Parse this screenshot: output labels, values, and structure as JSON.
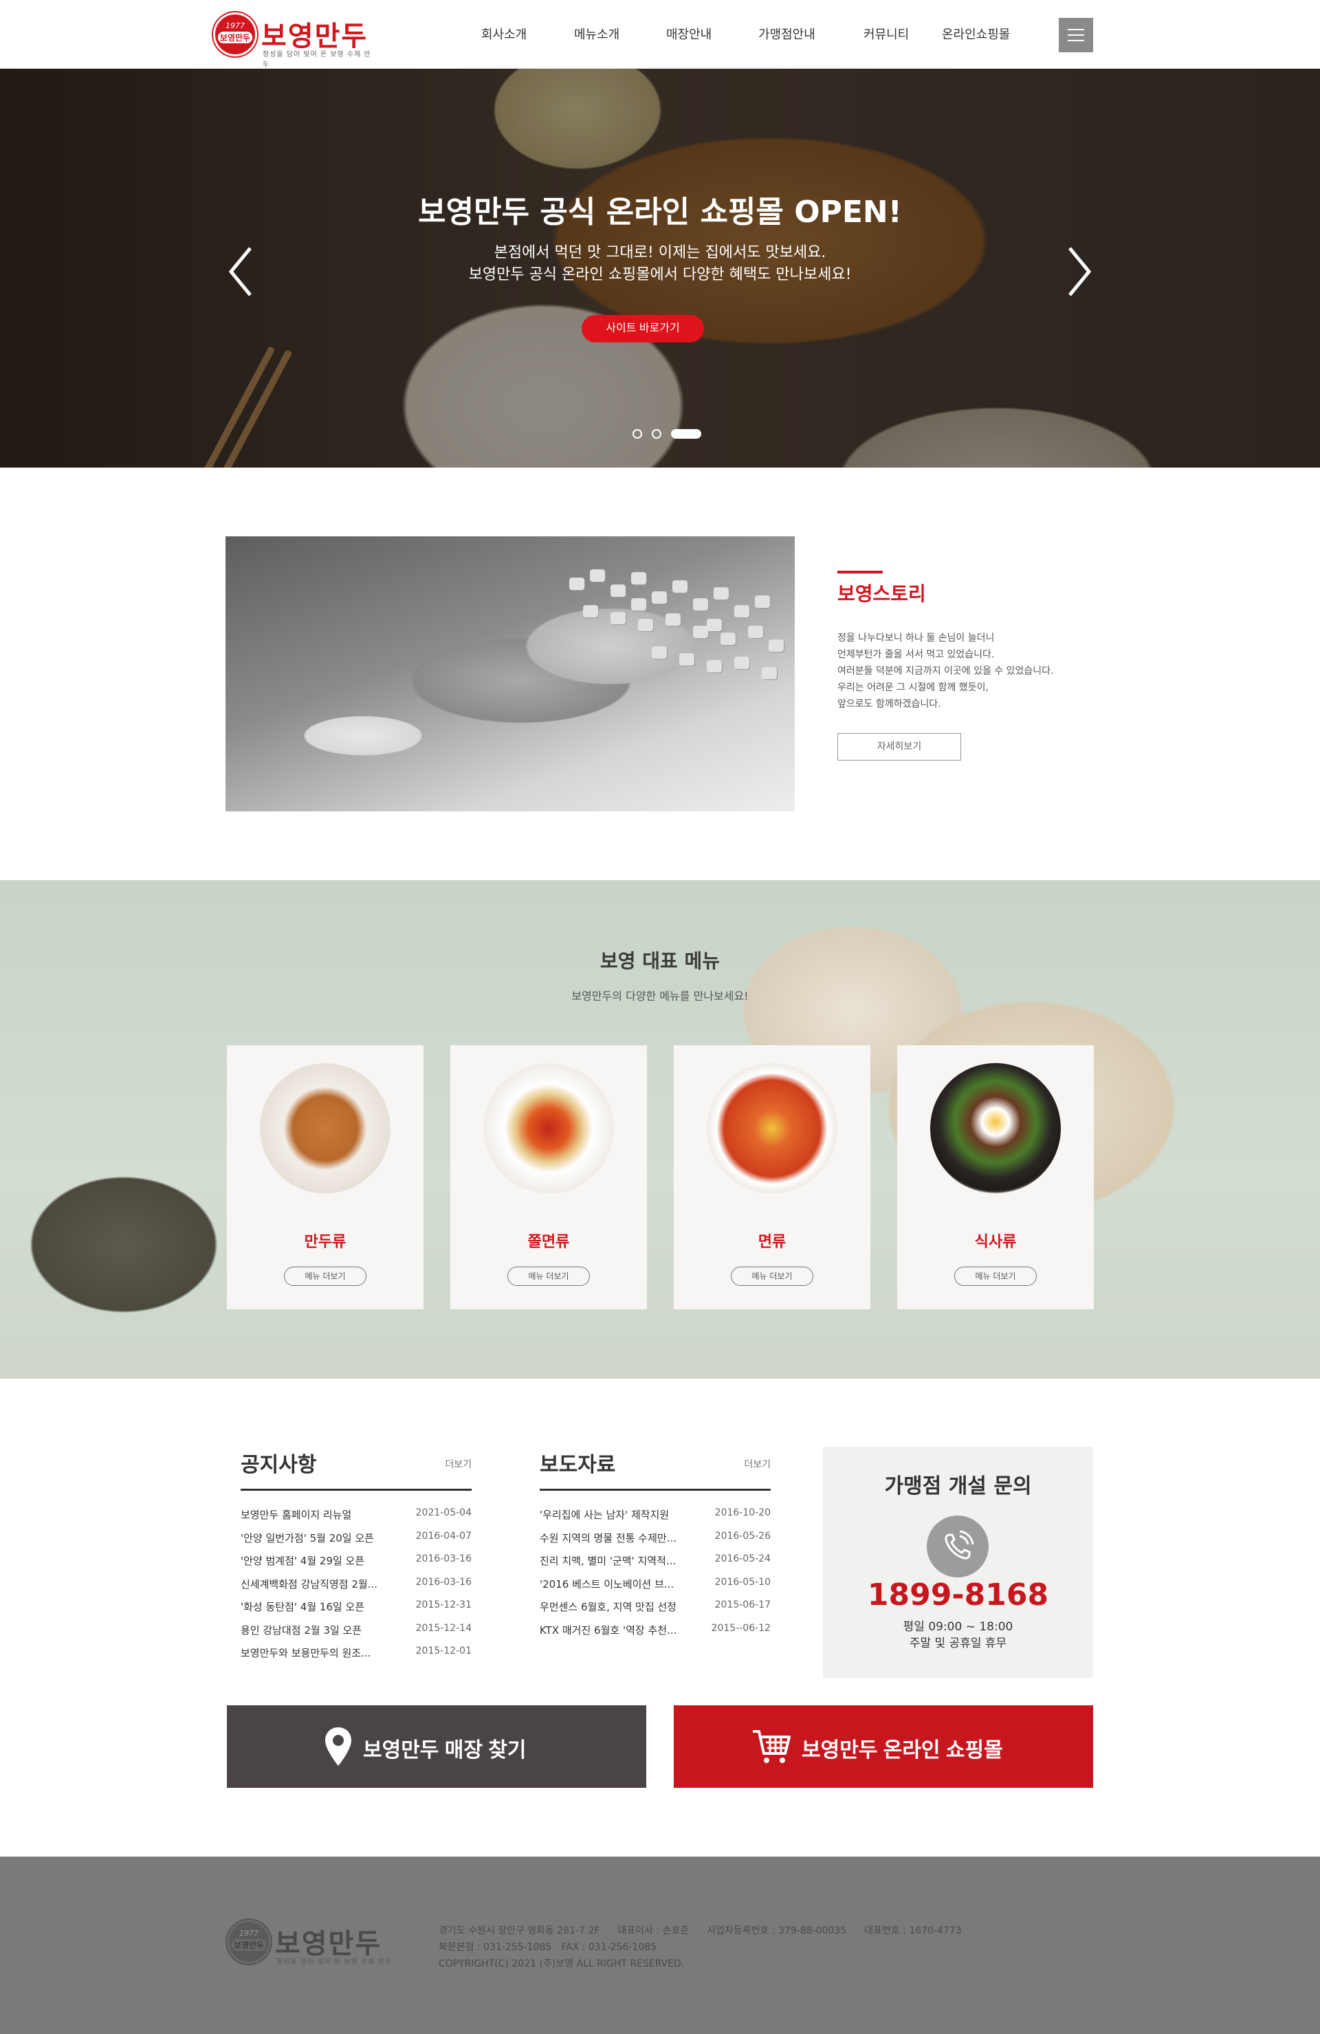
{
  "header": {
    "logo": {
      "year": "1977",
      "seal_name": "보영만두",
      "brand": "보영만두",
      "tagline": "정성을 담아 빚어 온 보영 수제 만두"
    },
    "nav": [
      "회사소개",
      "메뉴소개",
      "매장안내",
      "가맹점안내",
      "커뮤니티",
      "온라인쇼핑몰"
    ]
  },
  "hero": {
    "title": "보영만두 공식 온라인 쇼핑몰 OPEN!",
    "subtitle_lines": [
      "본점에서 먹던 맛 그대로! 이제는 집에서도 맛보세요.",
      "보영만두 공식 온라인 쇼핑몰에서 다양한 혜택도 만나보세요!"
    ],
    "button": "사이트 바로가기",
    "slide_count": 3,
    "active_slide": 3
  },
  "story": {
    "title": "보영스토리",
    "lines": [
      "정을 나누다보니 하나 둘 손님이 늘더니",
      "언제부턴가 줄을 서서 먹고 있었습니다.",
      "여러분들 덕분에 지금까지 이곳에 있을 수 있었습니다.",
      "우리는 어려운 그 시절에 함께 했듯이,",
      "앞으로도 함께하겠습니다."
    ],
    "button": "자세히보기"
  },
  "menu": {
    "title": "보영 대표 메뉴",
    "subtitle": "보영만두의 다양한 메뉴를 만나보세요!",
    "items": [
      {
        "name": "만두류",
        "button": "메뉴 더보기"
      },
      {
        "name": "쫄면류",
        "button": "메뉴 더보기"
      },
      {
        "name": "면류",
        "button": "메뉴 더보기"
      },
      {
        "name": "식사류",
        "button": "메뉴 더보기"
      }
    ]
  },
  "notice": {
    "title": "공지사항",
    "more": "더보기",
    "rows": [
      {
        "title": "보영만두 홈페이지 리뉴얼",
        "date": "2021-05-04"
      },
      {
        "title": "'안양 일번가점' 5월 20일 오픈",
        "date": "2016-04-07"
      },
      {
        "title": "'안양 범계점' 4월 29일 오픈",
        "date": "2016-03-16"
      },
      {
        "title": "신세계백화점 강남직영점 2월...",
        "date": "2016-03-16"
      },
      {
        "title": "'화성 동탄점' 4월 16일 오픈",
        "date": "2015-12-31"
      },
      {
        "title": "용인 강남대점 2월 3일 오픈",
        "date": "2015-12-14"
      },
      {
        "title": "보영만두와 보용만두의 원조...",
        "date": "2015-12-01"
      }
    ]
  },
  "press": {
    "title": "보도자료",
    "more": "더보기",
    "rows": [
      {
        "title": "'우리집에 사는 남자' 제작지원",
        "date": "2016-10-20"
      },
      {
        "title": "수원 지역의 명물 전통 수제만...",
        "date": "2016-05-26"
      },
      {
        "title": "진리 치맥, 별미 '군맥' 지역적...",
        "date": "2016-05-24"
      },
      {
        "title": "'2016 베스트 이노베이션 브...",
        "date": "2016-05-10"
      },
      {
        "title": "우먼센스 6월호, 지역 맛집 선정",
        "date": "2015-06-17"
      },
      {
        "title": "KTX 매거진 6월호 '역장 추천...",
        "date": "2015--06-12"
      }
    ]
  },
  "franchise": {
    "title": "가맹점 개설 문의",
    "phone": "1899-8168",
    "hours": [
      "평일 09:00 ~ 18:00",
      "주말 및 공휴일 휴무"
    ]
  },
  "actions": {
    "store": "보영만두 매장 찾기",
    "mall": "보영만두 온라인 쇼핑몰"
  },
  "colors": {
    "brand_red": "#d2161e",
    "button_red": "#c8161e",
    "store_button": "#4a4444",
    "footer_bg": "#7a7a7a"
  },
  "footer": {
    "logo": {
      "year": "1977",
      "seal_name": "보영만두",
      "brand": "보영만두",
      "tagline": "정성을 담아 빚어 온 보영 수제 만두"
    },
    "address": "경기도 수원시 장안구 영화동 281-7 2F",
    "ceo": "대표이사 : 손효준",
    "biz_no": "사업자등록번호 : 379-88-00035",
    "tel": "대표번호 : 1670-4773",
    "branch_tel": "북문본점 : 031-255-1085",
    "fax": "FAX : 031-256-1085",
    "copyright": "COPYRIGHT(C) 2021 (주)보영 ALL RIGHT RESERVED."
  }
}
